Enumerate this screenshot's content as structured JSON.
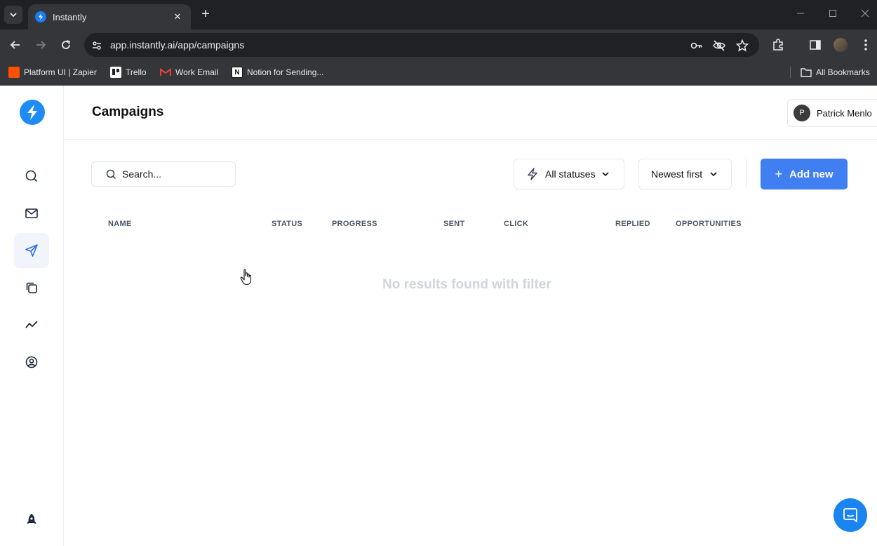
{
  "browser": {
    "tab": {
      "title": "Instantly",
      "close": "✕"
    },
    "new_tab": "+",
    "url": "app.instantly.ai/app/campaigns",
    "bookmarks": [
      {
        "label": "Platform UI | Zapier",
        "icon": "zapier-icon",
        "color": "#ff4f00"
      },
      {
        "label": "Trello",
        "icon": "trello-icon",
        "color": "#ffffff"
      },
      {
        "label": "Work Email",
        "icon": "gmail-icon",
        "color": "#ffffff"
      },
      {
        "label": "Notion for Sending...",
        "icon": "notion-icon",
        "color": "#ffffff"
      }
    ],
    "all_bookmarks": "All Bookmarks"
  },
  "sidebar": {
    "items": [
      {
        "name": "search",
        "icon": "search-icon"
      },
      {
        "name": "unibox",
        "icon": "mail-icon"
      },
      {
        "name": "campaigns",
        "icon": "send-icon",
        "active": true
      },
      {
        "name": "templates",
        "icon": "copy-icon"
      },
      {
        "name": "analytics",
        "icon": "chart-line-icon"
      },
      {
        "name": "account",
        "icon": "user-circle-icon"
      }
    ],
    "bottom_icon": "rocket-icon"
  },
  "header": {
    "title": "Campaigns",
    "user": {
      "initial": "P",
      "name": "Patrick Menlo"
    }
  },
  "toolbar": {
    "search_placeholder": "Search...",
    "status_filter": "All statuses",
    "sort": "Newest first",
    "add_label": "Add new",
    "add_plus": "+"
  },
  "table": {
    "columns": [
      "NAME",
      "STATUS",
      "PROGRESS",
      "SENT",
      "CLICK",
      "REPLIED",
      "OPPORTUNITIES"
    ],
    "empty_message": "No results found with filter"
  },
  "colors": {
    "accent": "#3f7ff1",
    "logo": "#1f8bf5",
    "chat": "#1a84f0"
  }
}
